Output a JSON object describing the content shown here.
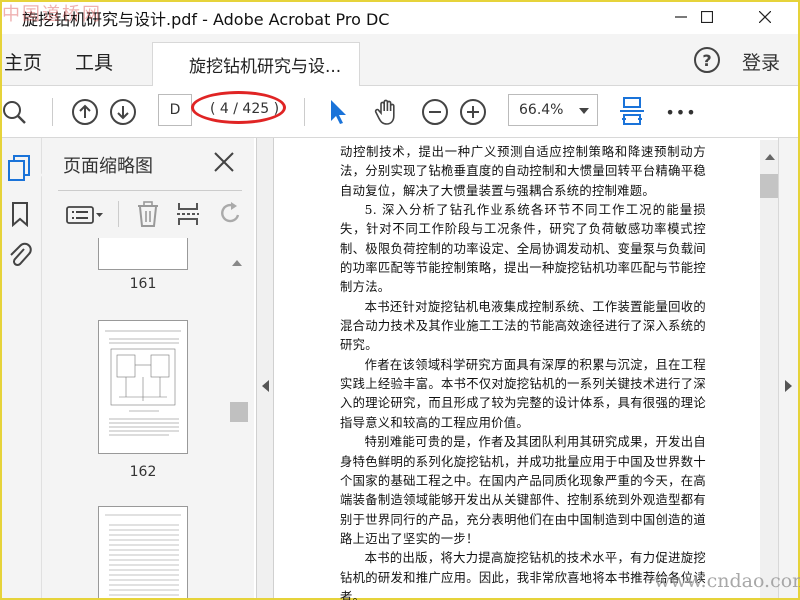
{
  "window": {
    "title": "旋挖钻机研究与设计.pdf - Adobe Acrobat Pro DC",
    "watermark_top": "中国道桥网"
  },
  "menu": {
    "home": "主页",
    "tools": "工具",
    "doc_tab": "旋挖钻机研究与设...",
    "help": "?",
    "login": "登录"
  },
  "toolbar": {
    "page_input": "D",
    "page_count": "( 4 / 425 )",
    "zoom": "66.4%",
    "more": "•••"
  },
  "thumbnails": {
    "title": "页面缩略图",
    "pages": [
      {
        "label": "161"
      },
      {
        "label": "162"
      }
    ]
  },
  "document": {
    "paragraphs": [
      {
        "cont": true,
        "text": "动控制技术，提出一种广义预测自适应控制策略和降速预制动方法，分别实现了钻桅垂直度的自动控制和大惯量回转平台精确平稳自动复位，解决了大惯量装置与强耦合系统的控制难题。"
      },
      {
        "cont": false,
        "text": "5. 深入分析了钻孔作业系统各环节不同工作工况的能量损失，针对不同工作阶段与工况条件，研究了负荷敏感功率模式控制、极限负荷控制的功率设定、全局协调发动机、变量泵与负载间的功率匹配等节能控制策略，提出一种旋挖钻机功率匹配与节能控制方法。"
      },
      {
        "cont": false,
        "text": "本书还针对旋挖钻机电液集成控制系统、工作装置能量回收的混合动力技术及其作业施工工法的节能高效途径进行了深入系统的研究。"
      },
      {
        "cont": false,
        "text": "作者在该领域科学研究方面具有深厚的积累与沉淀，且在工程实践上经验丰富。本书不仅对旋挖钻机的一系列关键技术进行了深入的理论研究，而且形成了较为完整的设计体系，具有很强的理论指导意义和较高的工程应用价值。"
      },
      {
        "cont": false,
        "text": "特别难能可贵的是，作者及其团队利用其研究成果，开发出自身特色鲜明的系列化旋挖钻机，并成功批量应用于中国及世界数十个国家的基础工程之中。在国内产品同质化现象严重的今天，在高端装备制造领域能够开发出从关键部件、控制系统到外观造型都有别于世界同行的产品，充分表明他们在由中国制造到中国创造的道路上迈出了坚实的一步！"
      },
      {
        "cont": false,
        "text": "本书的出版，将大力提高旋挖钻机的技术水平，有力促进旋挖钻机的研发和推广应用。因此，我非常欣喜地将本书推荐给各位读者。"
      }
    ],
    "watermark_bottom": "www.cndao.com"
  }
}
